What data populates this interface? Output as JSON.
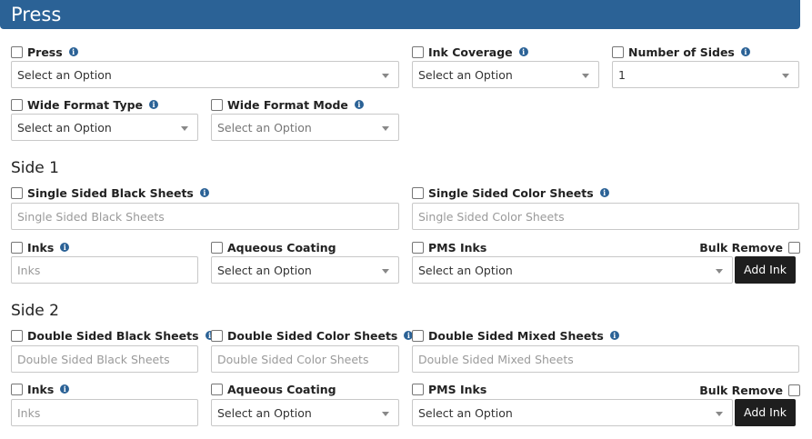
{
  "header": {
    "title": "Press"
  },
  "info_glyph": "i",
  "fields": {
    "press": {
      "label": "Press",
      "value": "Select an Option"
    },
    "ink_coverage": {
      "label": "Ink Coverage",
      "value": "Select an Option"
    },
    "number_of_sides": {
      "label": "Number of Sides",
      "value": "1"
    },
    "wide_format_type": {
      "label": "Wide Format Type",
      "value": "Select an Option"
    },
    "wide_format_mode": {
      "label": "Wide Format Mode",
      "value": "Select an Option"
    }
  },
  "side1": {
    "title": "Side 1",
    "single_black": {
      "label": "Single Sided Black Sheets",
      "placeholder": "Single Sided Black Sheets"
    },
    "single_color": {
      "label": "Single Sided Color Sheets",
      "placeholder": "Single Sided Color Sheets"
    },
    "inks": {
      "label": "Inks",
      "placeholder": "Inks"
    },
    "aqueous": {
      "label": "Aqueous Coating",
      "value": "Select an Option"
    },
    "pms": {
      "label": "PMS Inks",
      "value": "Select an Option"
    },
    "bulk_remove": "Bulk Remove",
    "add_ink": "Add Ink"
  },
  "side2": {
    "title": "Side 2",
    "double_black": {
      "label": "Double Sided Black Sheets",
      "placeholder": "Double Sided Black Sheets"
    },
    "double_color": {
      "label": "Double Sided Color Sheets",
      "placeholder": "Double Sided Color Sheets"
    },
    "double_mixed": {
      "label": "Double Sided Mixed Sheets",
      "placeholder": "Double Sided Mixed Sheets"
    },
    "inks": {
      "label": "Inks",
      "placeholder": "Inks"
    },
    "aqueous": {
      "label": "Aqueous Coating",
      "value": "Select an Option"
    },
    "pms": {
      "label": "PMS Inks",
      "value": "Select an Option"
    },
    "bulk_remove": "Bulk Remove",
    "add_ink": "Add Ink"
  },
  "colors": {
    "header_bg": "#2b6296",
    "info_icon": "#2b6296",
    "button_bg": "#1e1e1e"
  }
}
